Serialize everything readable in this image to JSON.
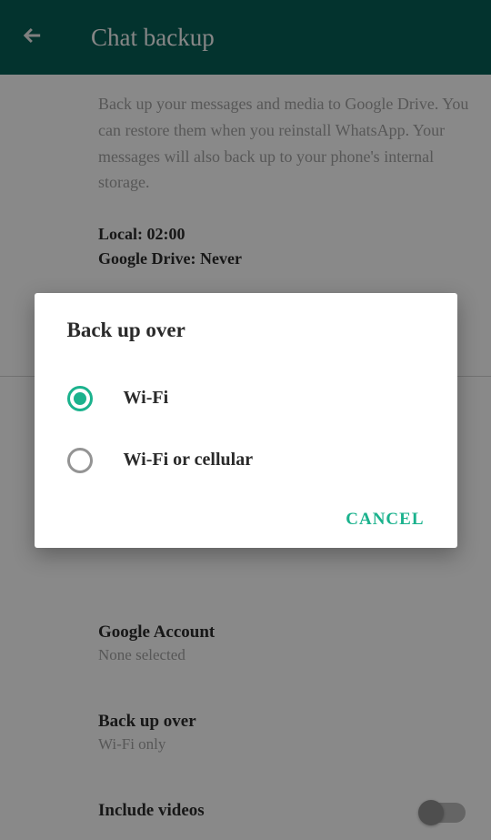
{
  "header": {
    "title": "Chat backup"
  },
  "main": {
    "description": "Back up your messages and media to Google Drive. You can restore them when you reinstall WhatsApp. Your messages will also back up to your phone's internal storage.",
    "local_line": "Local: 02:00",
    "gdrive_line": "Google Drive: Never"
  },
  "settings": {
    "account": {
      "label": "Google Account",
      "value": "None selected"
    },
    "backup_over": {
      "label": "Back up over",
      "value": "Wi-Fi only"
    },
    "include_videos": {
      "label": "Include videos",
      "checked": false
    }
  },
  "dialog": {
    "title": "Back up over",
    "options": [
      {
        "label": "Wi-Fi",
        "selected": true
      },
      {
        "label": "Wi-Fi or cellular",
        "selected": false
      }
    ],
    "cancel": "CANCEL"
  }
}
